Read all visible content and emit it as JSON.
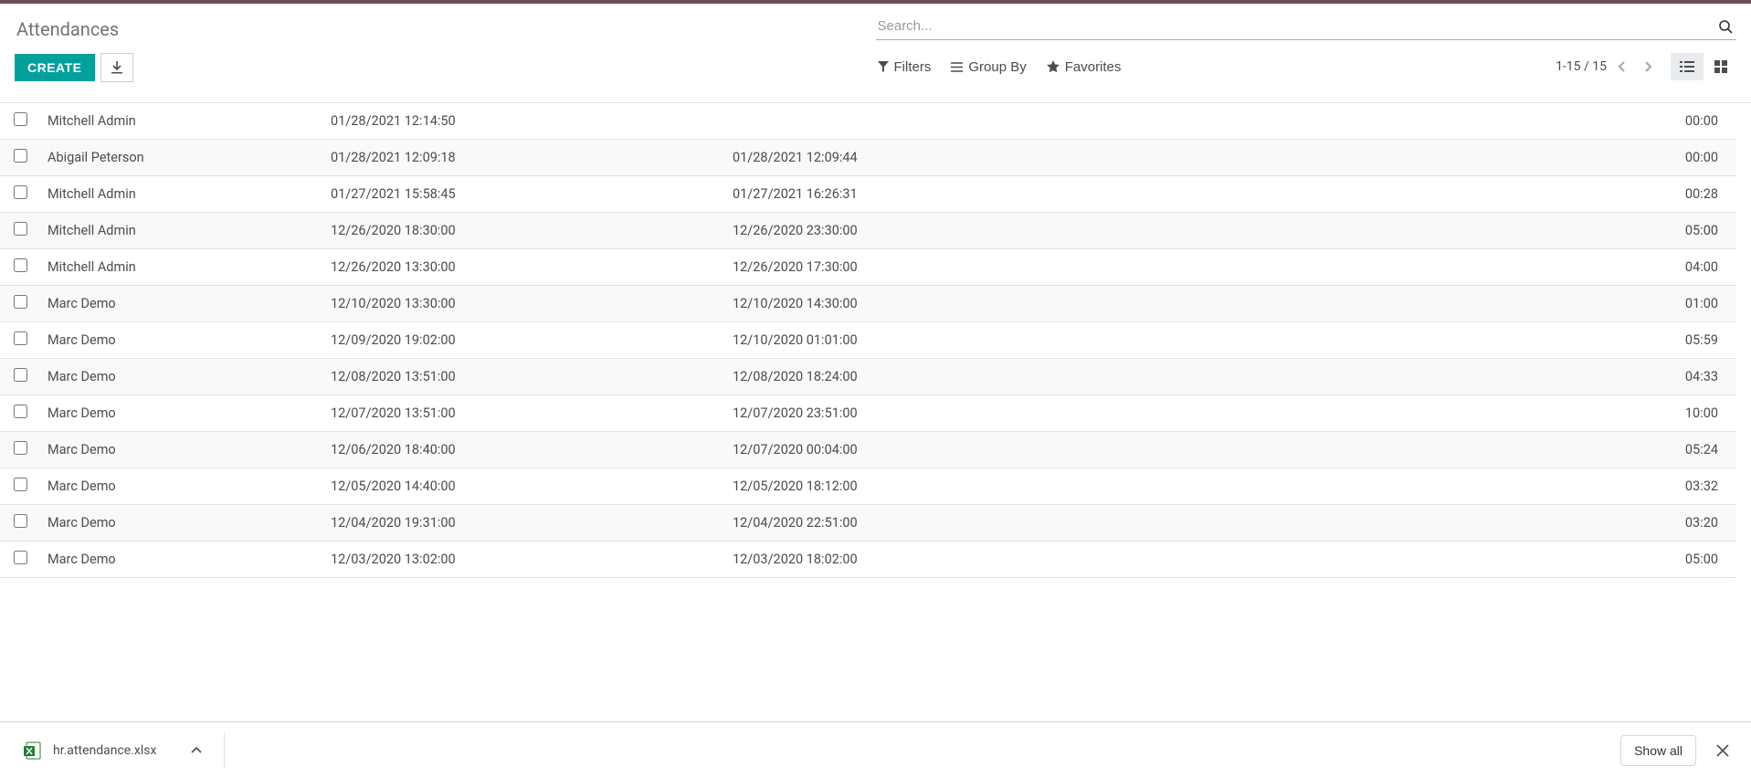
{
  "header": {
    "title": "Attendances",
    "create_label": "Create"
  },
  "search": {
    "placeholder": "Search..."
  },
  "filters": {
    "filters_label": "Filters",
    "groupby_label": "Group By",
    "favorites_label": "Favorites"
  },
  "pager": {
    "range": "1-15 / 15"
  },
  "rows": [
    {
      "employee": "Mitchell Admin",
      "checkin": "01/28/2021 12:14:50",
      "checkout": "",
      "hours": "00:00"
    },
    {
      "employee": "Abigail Peterson",
      "checkin": "01/28/2021 12:09:18",
      "checkout": "01/28/2021 12:09:44",
      "hours": "00:00"
    },
    {
      "employee": "Mitchell Admin",
      "checkin": "01/27/2021 15:58:45",
      "checkout": "01/27/2021 16:26:31",
      "hours": "00:28"
    },
    {
      "employee": "Mitchell Admin",
      "checkin": "12/26/2020 18:30:00",
      "checkout": "12/26/2020 23:30:00",
      "hours": "05:00"
    },
    {
      "employee": "Mitchell Admin",
      "checkin": "12/26/2020 13:30:00",
      "checkout": "12/26/2020 17:30:00",
      "hours": "04:00"
    },
    {
      "employee": "Marc Demo",
      "checkin": "12/10/2020 13:30:00",
      "checkout": "12/10/2020 14:30:00",
      "hours": "01:00"
    },
    {
      "employee": "Marc Demo",
      "checkin": "12/09/2020 19:02:00",
      "checkout": "12/10/2020 01:01:00",
      "hours": "05:59"
    },
    {
      "employee": "Marc Demo",
      "checkin": "12/08/2020 13:51:00",
      "checkout": "12/08/2020 18:24:00",
      "hours": "04:33"
    },
    {
      "employee": "Marc Demo",
      "checkin": "12/07/2020 13:51:00",
      "checkout": "12/07/2020 23:51:00",
      "hours": "10:00"
    },
    {
      "employee": "Marc Demo",
      "checkin": "12/06/2020 18:40:00",
      "checkout": "12/07/2020 00:04:00",
      "hours": "05:24"
    },
    {
      "employee": "Marc Demo",
      "checkin": "12/05/2020 14:40:00",
      "checkout": "12/05/2020 18:12:00",
      "hours": "03:32"
    },
    {
      "employee": "Marc Demo",
      "checkin": "12/04/2020 19:31:00",
      "checkout": "12/04/2020 22:51:00",
      "hours": "03:20"
    },
    {
      "employee": "Marc Demo",
      "checkin": "12/03/2020 13:02:00",
      "checkout": "12/03/2020 18:02:00",
      "hours": "05:00"
    }
  ],
  "download": {
    "filename": "hr.attendance.xlsx",
    "show_all_label": "Show all"
  }
}
